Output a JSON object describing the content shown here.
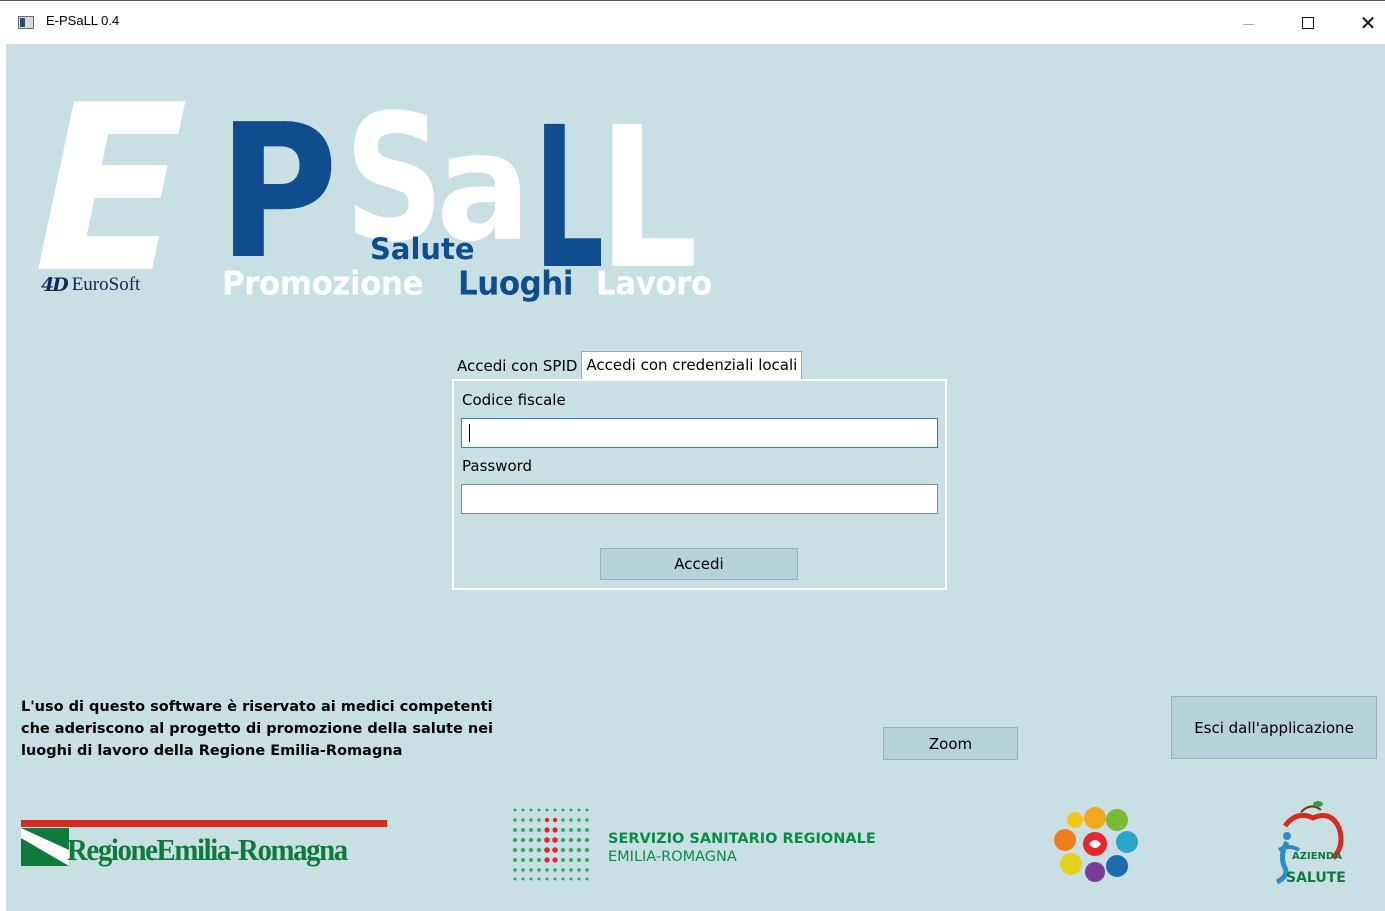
{
  "window": {
    "title": "E-PSaLL 0.4",
    "minimize_icon": "minimize-icon",
    "maximize_icon": "maximize-icon",
    "close_glyph": "✕"
  },
  "logo": {
    "letter_e": "E",
    "letter_p": "P",
    "letter_s": "S",
    "letter_a": "a",
    "letter_l1": "L",
    "letter_l2": "L",
    "salute": "Salute",
    "promozione": "Promozione",
    "luoghi": "Luoghi",
    "lavoro": "Lavoro",
    "eurosoft_mark": "4D",
    "eurosoft_name": "EuroSoft",
    "colors": {
      "dark_blue": "#0f4d8f",
      "white": "#ffffff"
    }
  },
  "tabs": [
    {
      "label": "Accedi con SPID",
      "active": false
    },
    {
      "label": "Accedi con credenziali locali",
      "active": true
    }
  ],
  "login": {
    "codice_label": "Codice fiscale",
    "codice_value": "",
    "password_label": "Password",
    "password_value": "",
    "submit_label": "Accedi"
  },
  "notice": {
    "line1": "L'uso di questo software è riservato ai medici competenti",
    "line2": "che aderiscono al progetto di promozione della salute nei",
    "line3": "luoghi di lavoro della Regione Emilia-Romagna"
  },
  "buttons": {
    "zoom": "Zoom",
    "exit": "Esci dall'applicazione"
  },
  "footer": {
    "regione": "RegioneEmilia-Romagna",
    "ssr_line1": "SERVIZIO SANITARIO REGIONALE",
    "ssr_line2": "EMILIA-ROMAGNA",
    "azienda_line1": "AZIENDA",
    "azienda_line2": "SALUTE",
    "colors": {
      "green": "#0f7a3c",
      "red": "#d62a1e"
    }
  },
  "background_color": "#c8e0e4"
}
